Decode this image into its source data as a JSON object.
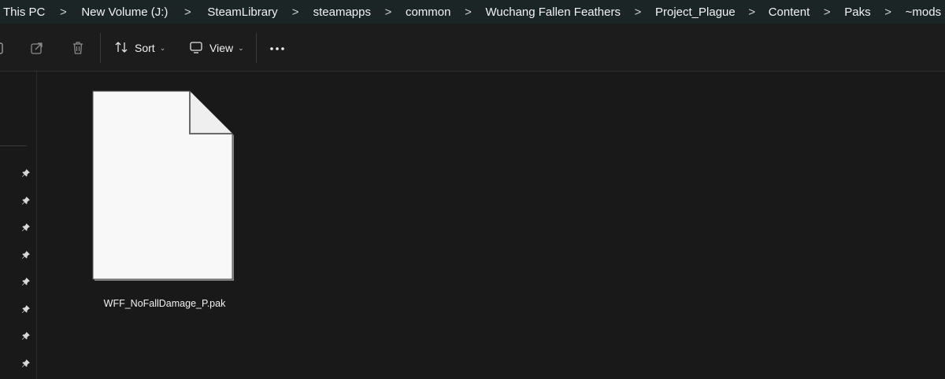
{
  "breadcrumb": {
    "items": [
      "This PC",
      "New Volume (J:)",
      "SteamLibrary",
      "steamapps",
      "common",
      "Wuchang Fallen Feathers",
      "Project_Plague",
      "Content",
      "Paks",
      "~mods"
    ],
    "separator": ">"
  },
  "toolbar": {
    "sort_label": "Sort",
    "view_label": "View",
    "more_label": "•••",
    "caret": "⌄"
  },
  "nav_pane": {
    "pin_count": 8
  },
  "files": [
    {
      "name": "WFF_NoFallDamage_P.pak",
      "icon": "blank-file-icon"
    }
  ],
  "colors": {
    "background": "#191919",
    "breadcrumb_bar": "#1c2526",
    "toolbar": "#1c1c1c",
    "text": "#f2f2f2",
    "file_icon": "#f8f8f8"
  }
}
